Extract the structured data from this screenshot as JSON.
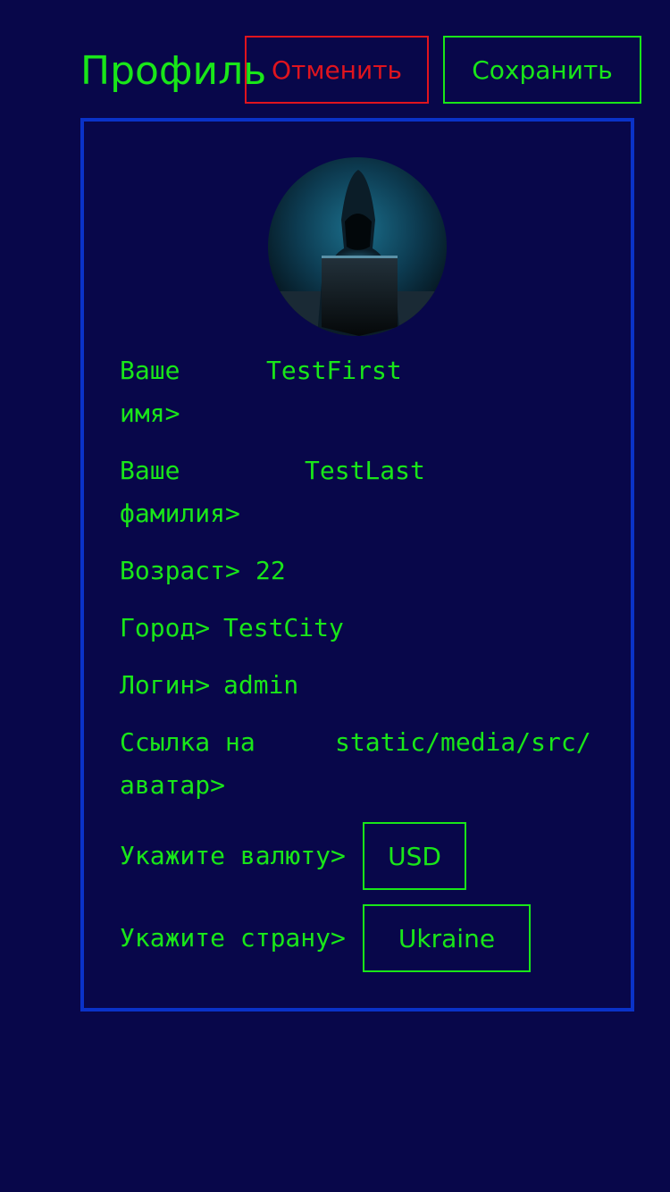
{
  "header": {
    "title": "Профиль",
    "cancel_label": "Отменить",
    "save_label": "Сохранить"
  },
  "avatar": {
    "icon": "hooded-hacker-avatar"
  },
  "fields": {
    "first_name": {
      "label_line1": "Ваше",
      "label_line2": "имя>",
      "value": "TestFirst"
    },
    "last_name": {
      "label_line1": "Ваше",
      "label_line2": "фамилия>",
      "value": "TestLast"
    },
    "age": {
      "label": "Возраст>",
      "value": "22"
    },
    "city": {
      "label": "Город>",
      "value": "TestCity"
    },
    "login": {
      "label": "Логин>",
      "value": "admin"
    },
    "avatar_link": {
      "label_line1": "Ссылка на",
      "label_line2": "аватар>",
      "value": "static/media/src/"
    },
    "currency": {
      "label": "Укажите валюту>",
      "value": "USD"
    },
    "country": {
      "label": "Укажите страну>",
      "value": "Ukraine"
    }
  },
  "colors": {
    "background": "#08074a",
    "accent": "#19e619",
    "danger": "#e0141e",
    "card_border": "#0a32c8"
  }
}
